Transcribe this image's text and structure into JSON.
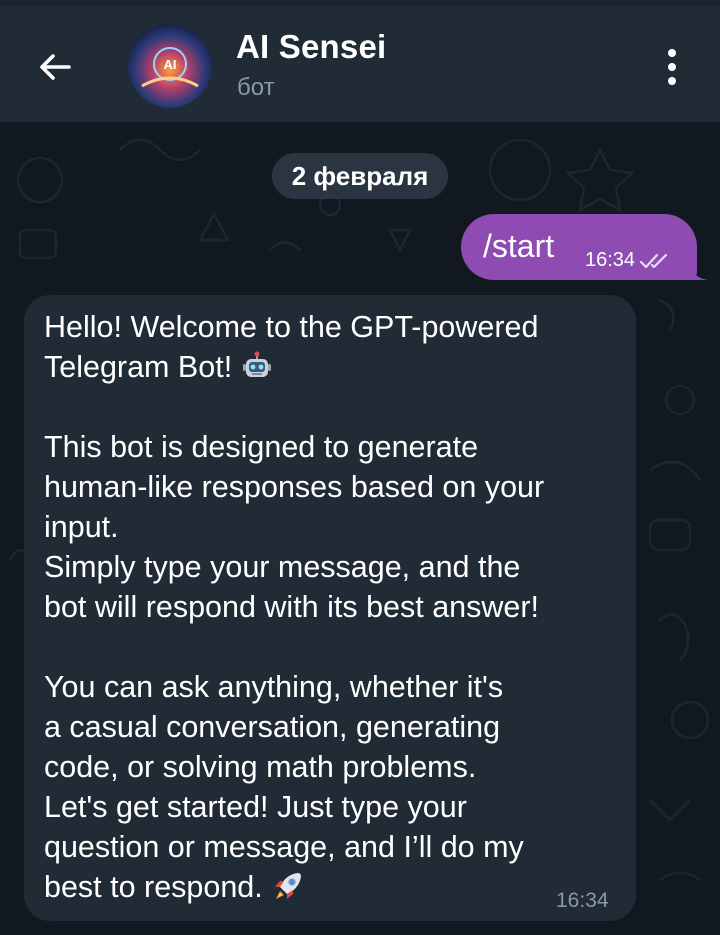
{
  "header": {
    "title": "AI Sensei",
    "subtitle": "бот",
    "avatar_label": "AI"
  },
  "chat": {
    "date_label": "2 февраля",
    "messages": [
      {
        "direction": "outgoing",
        "text": "/start",
        "time": "16:34",
        "status": "read"
      },
      {
        "direction": "incoming",
        "time": "16:34",
        "paragraphs": [
          {
            "lines": [
              "Hello! Welcome to the GPT-powered",
              "Telegram Bot!"
            ],
            "emoji": "robot-emoji"
          },
          {
            "lines": [
              "This bot is designed to generate",
              "human-like responses based on your",
              "input.",
              "Simply type your message, and the",
              "bot will respond with its best answer!"
            ]
          },
          {
            "lines": [
              "You can ask anything, whether it's",
              "a casual conversation, generating",
              "code, or solving math problems.",
              "Let's get started! Just type your",
              "question or message, and I’ll do my",
              "best to respond."
            ],
            "emoji": "rocket-emoji"
          }
        ]
      }
    ]
  },
  "colors": {
    "background": "#111820",
    "header": "#212b35",
    "outgoing_bubble": "#8e4bb1",
    "incoming_bubble": "#212b35",
    "muted_text": "#8b98a6"
  },
  "icons": {
    "back": "arrow-left-icon",
    "menu": "more-vertical-icon",
    "read_status": "double-check-icon"
  }
}
